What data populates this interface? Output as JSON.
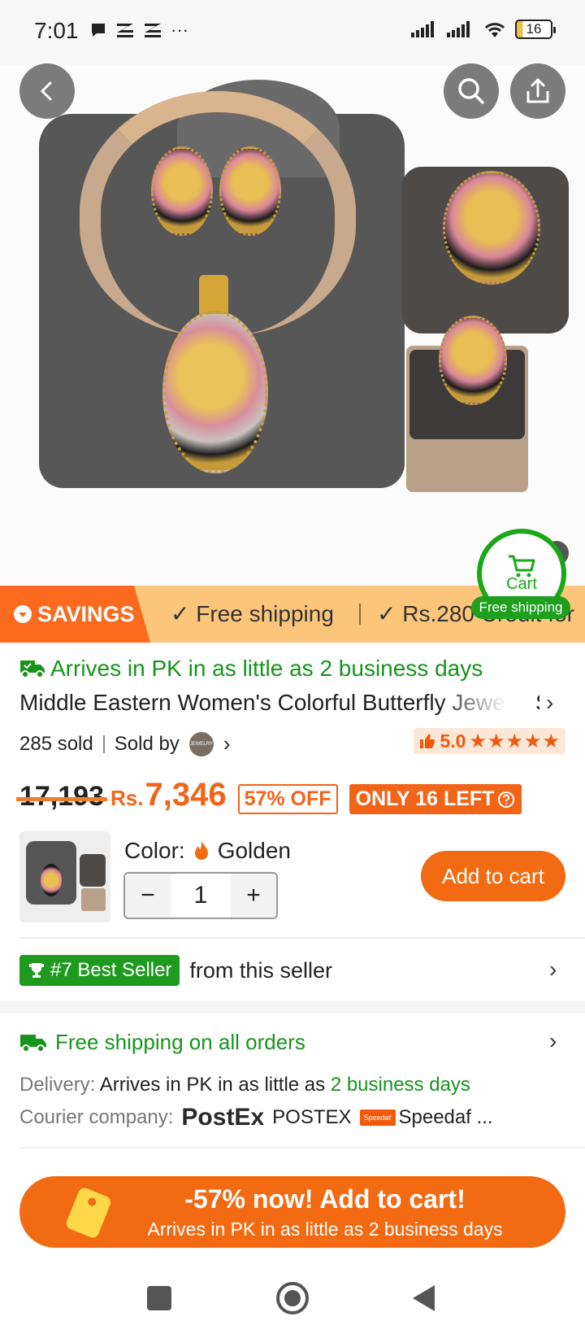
{
  "status_bar": {
    "time": "7:01",
    "more": "···",
    "battery": "16"
  },
  "header": {
    "back_icon": "chevron-left-icon",
    "search_icon": "search-icon",
    "share_icon": "share-icon"
  },
  "cart_float": {
    "label": "Cart",
    "badge": "Free shipping"
  },
  "savings_banner": {
    "tag": "SAVINGS",
    "items": [
      "Free shipping",
      "Rs.280 Credit for"
    ]
  },
  "product": {
    "arrives": "Arrives in PK in as little as 2 business days",
    "title": "Middle Eastern Women's Colorful Butterfly Jewelry Set",
    "sold": "285 sold",
    "sold_by": "Sold by",
    "seller_logo_text": "JEWELRY",
    "rating": "5.0",
    "stars": "★★★★★",
    "old_price": "17,193",
    "currency": "Rs.",
    "price": "7,346",
    "discount": "57% OFF",
    "stock": "ONLY 16 LEFT"
  },
  "variant": {
    "color_label": "Color:",
    "color_value": "Golden",
    "quantity": "1",
    "minus": "−",
    "plus": "+",
    "add_to_cart": "Add to cart"
  },
  "best_seller": {
    "badge": "#7 Best Seller",
    "text": "from this seller"
  },
  "shipping": {
    "title": "Free shipping on all orders",
    "delivery_label": "Delivery:",
    "delivery_text": "Arrives in PK in as little as",
    "delivery_highlight": "2 business days",
    "courier_label": "Courier company:",
    "postex_logo": "PostEx",
    "postex_name": "POSTEX",
    "speedaf_logo": "Speedaf",
    "speedaf_name": "Speedaf ..."
  },
  "cta": {
    "main": "-57% now! Add to cart!",
    "sub": "Arrives in PK in as little as 2 business days"
  },
  "colors": {
    "accent": "#f26a12",
    "green": "#17941b",
    "banner": "#fcc67a"
  }
}
